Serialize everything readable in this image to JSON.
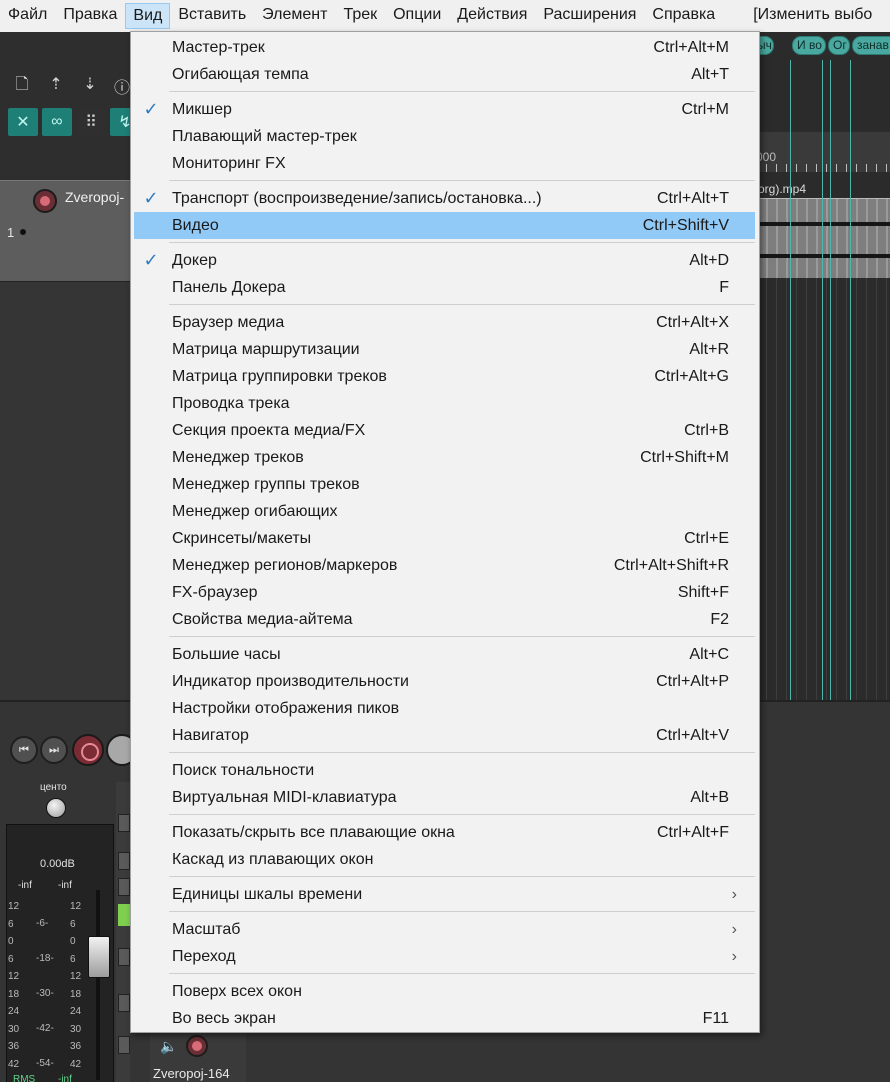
{
  "menubar": {
    "items": [
      {
        "label": "Файл"
      },
      {
        "label": "Правка"
      },
      {
        "label": "Вид"
      },
      {
        "label": "Вставить"
      },
      {
        "label": "Элемент"
      },
      {
        "label": "Трек"
      },
      {
        "label": "Опции"
      },
      {
        "label": "Действия"
      },
      {
        "label": "Расширения"
      },
      {
        "label": "Справка"
      }
    ],
    "extra_label": "[Изменить выбо"
  },
  "view_menu": {
    "items": [
      {
        "label": "Мастер-трек",
        "shortcut": "Ctrl+Alt+M"
      },
      {
        "label": "Огибающая темпа",
        "shortcut": "Alt+T"
      },
      {
        "label": "Микшер",
        "shortcut": "Ctrl+M"
      },
      {
        "label": "Плавающий мастер-трек",
        "shortcut": ""
      },
      {
        "label": "Мониторинг FX",
        "shortcut": ""
      },
      {
        "label": "Транспорт (воспроизведение/запись/остановка...)",
        "shortcut": "Ctrl+Alt+T"
      },
      {
        "label": "Видео",
        "shortcut": "Ctrl+Shift+V"
      },
      {
        "label": "Докер",
        "shortcut": "Alt+D"
      },
      {
        "label": "Панель Докера",
        "shortcut": "F"
      },
      {
        "label": "Браузер медиа",
        "shortcut": "Ctrl+Alt+X"
      },
      {
        "label": "Матрица маршрутизации",
        "shortcut": "Alt+R"
      },
      {
        "label": "Матрица группировки треков",
        "shortcut": "Ctrl+Alt+G"
      },
      {
        "label": "Проводка трека",
        "shortcut": ""
      },
      {
        "label": "Секция проекта медиа/FX",
        "shortcut": "Ctrl+B"
      },
      {
        "label": "Менеджер треков",
        "shortcut": "Ctrl+Shift+M"
      },
      {
        "label": "Менеджер группы треков",
        "shortcut": ""
      },
      {
        "label": "Менеджер огибающих",
        "shortcut": ""
      },
      {
        "label": "Скринсеты/макеты",
        "shortcut": "Ctrl+E"
      },
      {
        "label": "Менеджер регионов/маркеров",
        "shortcut": "Ctrl+Alt+Shift+R"
      },
      {
        "label": "FX-браузер",
        "shortcut": "Shift+F"
      },
      {
        "label": "Свойства медиа-айтема",
        "shortcut": "F2"
      },
      {
        "label": "Большие часы",
        "shortcut": "Alt+C"
      },
      {
        "label": "Индикатор производительности",
        "shortcut": "Ctrl+Alt+P"
      },
      {
        "label": "Настройки отображения пиков",
        "shortcut": ""
      },
      {
        "label": "Навигатор",
        "shortcut": "Ctrl+Alt+V"
      },
      {
        "label": "Поиск тональности",
        "shortcut": ""
      },
      {
        "label": "Виртуальная MIDI-клавиатура",
        "shortcut": "Alt+B"
      },
      {
        "label": "Показать/скрыть все плавающие окна",
        "shortcut": "Ctrl+Alt+F"
      },
      {
        "label": "Каскад из плавающих окон",
        "shortcut": ""
      },
      {
        "label": "Единицы шкалы времени",
        "shortcut": ""
      },
      {
        "label": "Масштаб",
        "shortcut": ""
      },
      {
        "label": "Переход",
        "shortcut": ""
      },
      {
        "label": "Поверх всех окон",
        "shortcut": ""
      },
      {
        "label": "Во весь экран",
        "shortcut": "F11"
      }
    ],
    "check_glyph": "✓",
    "submenu_glyph": "›"
  },
  "background": {
    "track_name": "Zveropoj-",
    "track_number": "1",
    "region_labels": [
      "ыч",
      "И во",
      "Ог",
      "занав"
    ],
    "ruler_label": "000",
    "media_label": "org).mp4",
    "pan_label": "центо",
    "db_readout": "0.00dB",
    "peak_left": "-inf",
    "peak_right": "-inf",
    "scale_left": [
      "12",
      "6",
      "0",
      "6",
      "12",
      "18",
      "24",
      "30",
      "36",
      "42"
    ],
    "scale_mid": [
      "-6-",
      "-18-",
      "-30-",
      "-42-",
      "-54-"
    ],
    "scale_right": [
      "12",
      "6",
      "0",
      "6",
      "12",
      "18",
      "24",
      "30",
      "36",
      "42"
    ],
    "rms_label": "RMS",
    "rms_value": "-inf",
    "channel_name": "Zveropoj-164",
    "accent_teal": "#1d7f76",
    "highlight_color": "#91c9f7"
  }
}
